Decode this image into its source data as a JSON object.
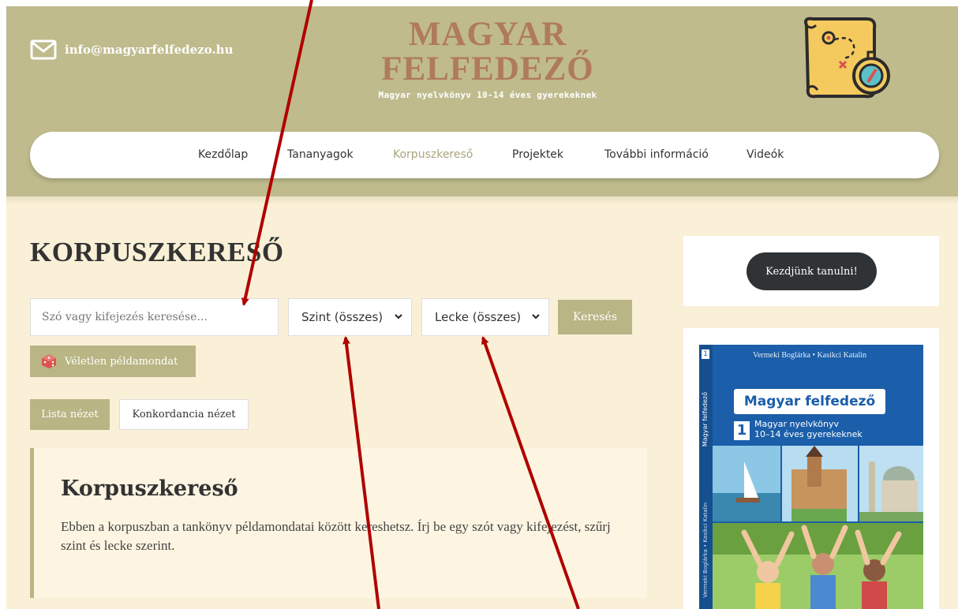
{
  "header": {
    "email": "info@magyarfelfedezo.hu",
    "brand_line1": "MAGYAR",
    "brand_line2": "FELFEDEZŐ",
    "tagline": "Magyar nyelvkönyv 10-14 éves gyerekeknek"
  },
  "nav": {
    "items": [
      {
        "label": "Kezdőlap"
      },
      {
        "label": "Tananyagok"
      },
      {
        "label": "Korpuszkereső"
      },
      {
        "label": "Projektek"
      },
      {
        "label": "További információ"
      },
      {
        "label": "Videók"
      }
    ],
    "active": "Korpuszkereső"
  },
  "main": {
    "title": "KORPUSZKERESŐ",
    "search_placeholder": "Szó vagy kifejezés keresése...",
    "level_select": "Szint (összes)",
    "lesson_select": "Lecke (összes)",
    "search_button": "Keresés",
    "random_button": "Véletlen példamondat",
    "list_view": "Lista nézet",
    "concordance_view": "Konkordancia nézet",
    "info_title": "Korpuszkereső",
    "info_text": "Ebben a korpuszban a tankönyv példamondatai között kereshetsz. Írj be egy szót vagy kifejezést, szűrj szint és lecke szerint."
  },
  "sidebar": {
    "start_button": "Kezdjünk tanulni!",
    "book": {
      "authors": "Vermeki Boglárka • Kasikci Katalin",
      "title": "Magyar felfedező",
      "number": "1",
      "subtitle_line1": "Magyar nyelvkönyv",
      "subtitle_line2": "10–14 éves gyerekeknek",
      "spine_title": "Magyar felfedező",
      "spine_authors": "Vermeki Boglárka • Kasikci Katalin"
    }
  },
  "colors": {
    "header_bg": "#bfbb8d",
    "brand": "#b07a5d",
    "accent": "#b9b584",
    "content_bg": "#faf0d7",
    "arrow": "#b00000"
  },
  "icons": [
    "envelope-icon",
    "treasure-map-icon",
    "chevron-down-icon",
    "dice-icon"
  ]
}
